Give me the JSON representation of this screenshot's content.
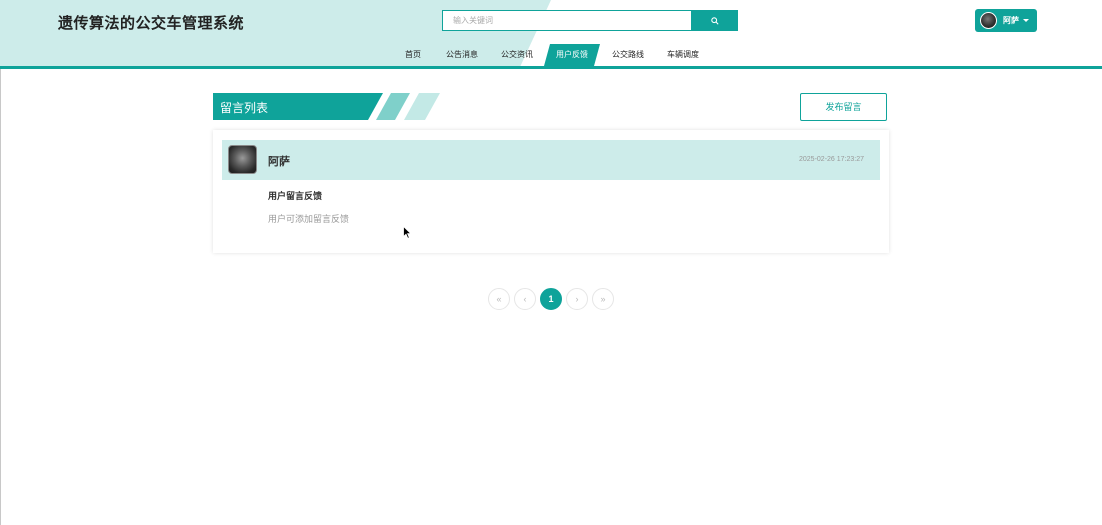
{
  "header": {
    "site_title": "遗传算法的公交车管理系统",
    "search_placeholder": "输入关键词",
    "search_icon": "search-icon",
    "user_name": "阿萨"
  },
  "nav": {
    "items": [
      {
        "label": "首页",
        "active": false
      },
      {
        "label": "公告消息",
        "active": false
      },
      {
        "label": "公交资讯",
        "active": false
      },
      {
        "label": "用户反馈",
        "active": true
      },
      {
        "label": "公交路线",
        "active": false
      },
      {
        "label": "车辆调度",
        "active": false
      }
    ]
  },
  "section": {
    "title": "留言列表",
    "post_button": "发布留言"
  },
  "messages": [
    {
      "user": "阿萨",
      "time": "2025-02-26 17:23:27",
      "title": "用户留言反馈",
      "content": "用户可添加留言反馈"
    }
  ],
  "pagination": {
    "first": "«",
    "prev": "‹",
    "current": "1",
    "next": "›",
    "last": "»"
  },
  "colors": {
    "accent": "#0fa39a",
    "accent_light": "#cdecea"
  }
}
